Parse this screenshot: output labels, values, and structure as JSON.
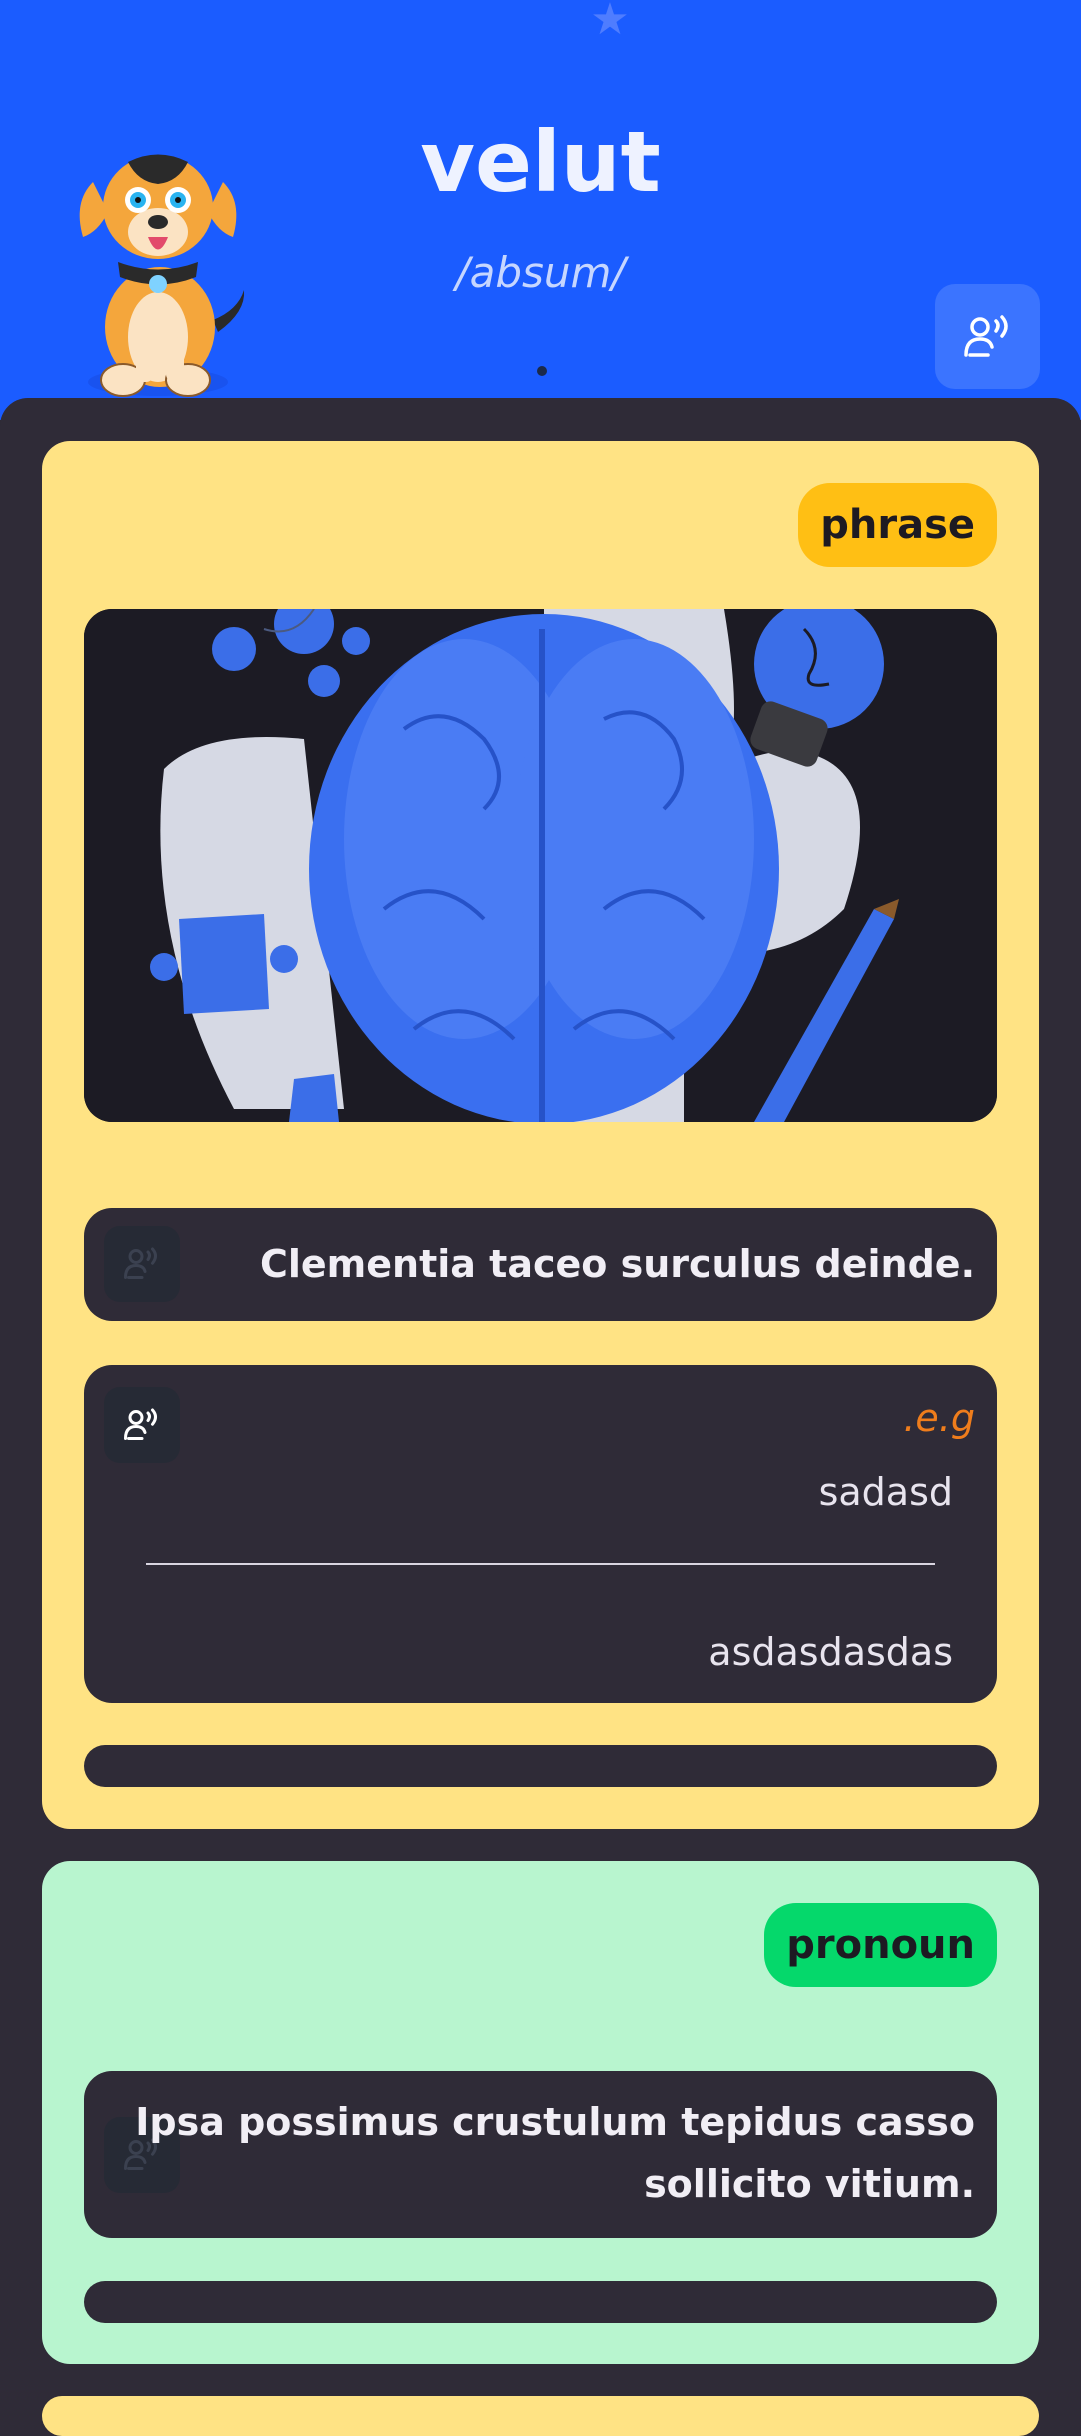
{
  "header": {
    "word": "velut",
    "phonetic": "/absum/",
    "audio_icon": "speaker-voice-icon",
    "mascot": "dog-mascot",
    "background": "#1b5cff"
  },
  "cards": [
    {
      "badge": "phrase",
      "color": "#ffe384",
      "image": "brain-illustration",
      "sentence": ".Clementia taceo surculus deinde",
      "example_label": ".e.g",
      "example_lines": [
        "sadasd",
        "asdasdasdas"
      ]
    },
    {
      "badge": "pronoun",
      "color": "#b8f5cf",
      "sentence_lines": [
        "Ipsa possimus crustulum tepidus casso",
        ".sollicito vitium"
      ]
    }
  ]
}
